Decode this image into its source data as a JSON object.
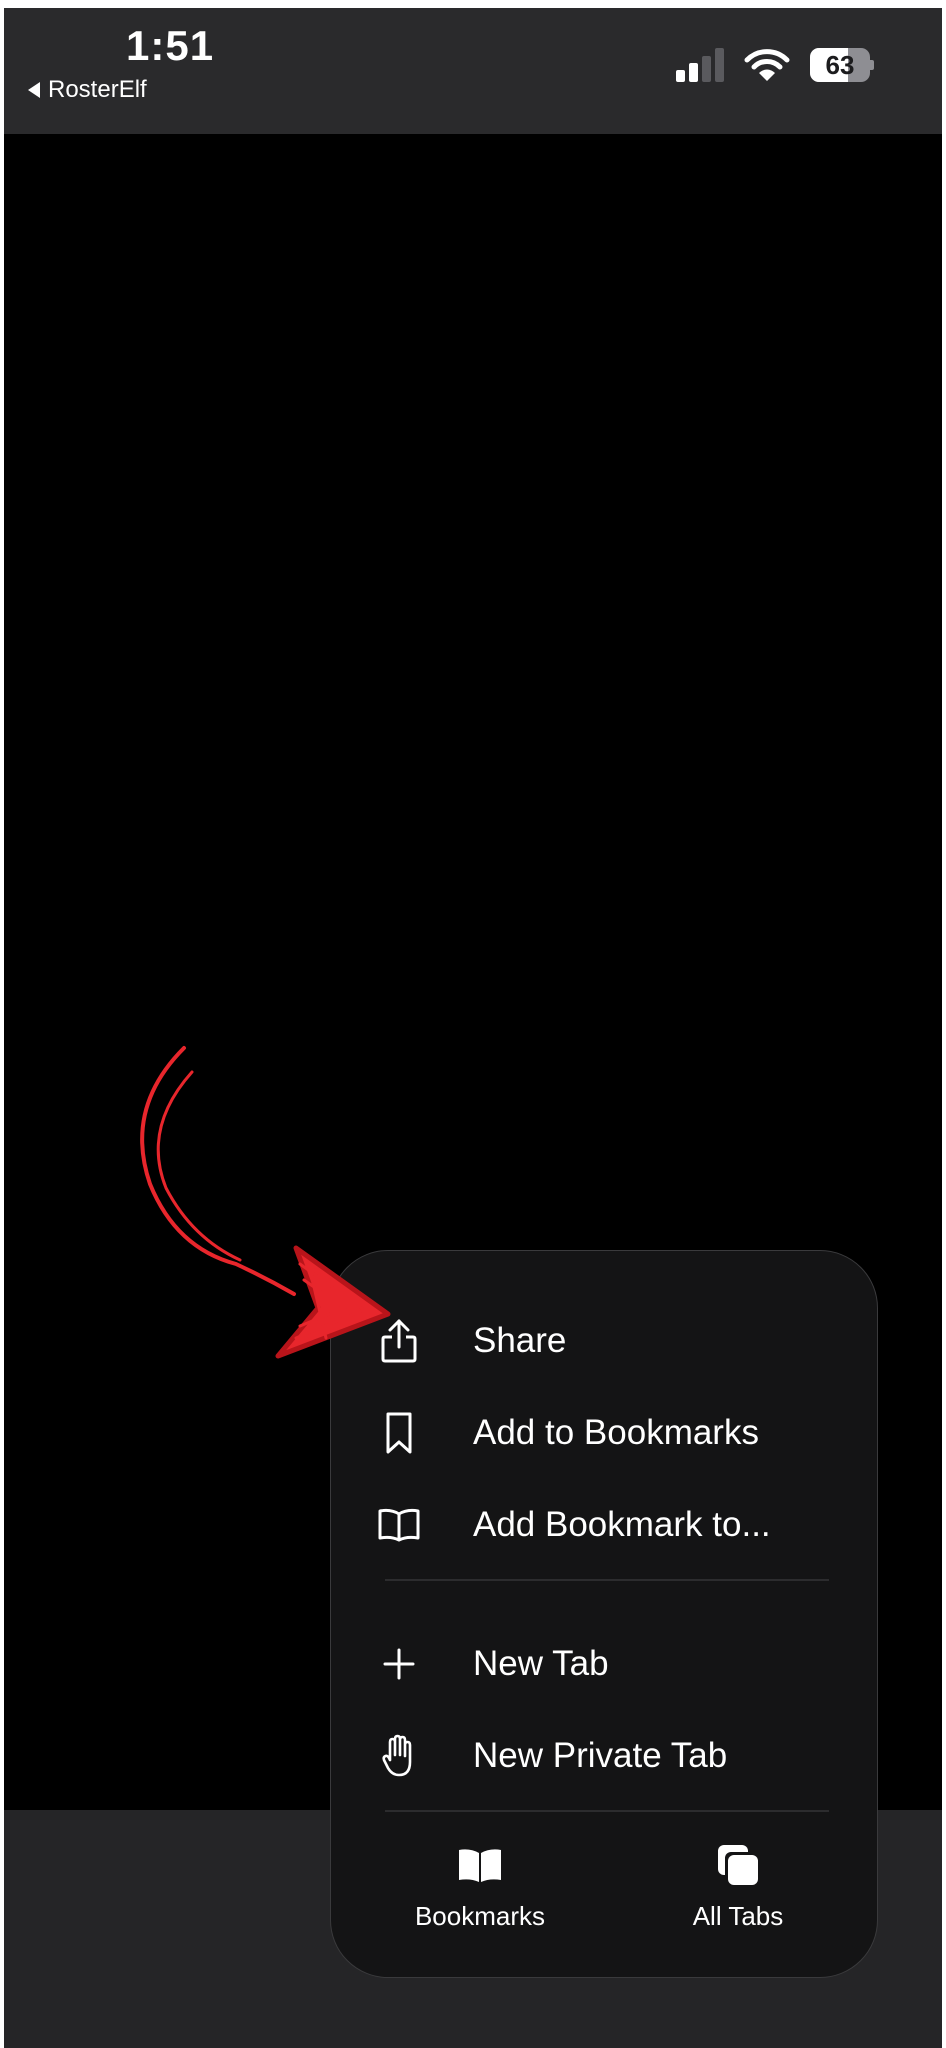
{
  "status_bar": {
    "time": "1:51",
    "back_label": "RosterElf",
    "battery_percent": "63",
    "battery_level": 0.63,
    "signal_bars_active": 2,
    "signal_bars_total": 4
  },
  "menu": {
    "items": [
      {
        "label": "Share",
        "icon": "share-icon"
      },
      {
        "label": "Add to Bookmarks",
        "icon": "bookmark-icon"
      },
      {
        "label": "Add Bookmark to...",
        "icon": "book-open-icon"
      },
      {
        "label": "New Tab",
        "icon": "plus-icon"
      },
      {
        "label": "New Private Tab",
        "icon": "hand-icon"
      }
    ],
    "bottom_buttons": [
      {
        "label": "Bookmarks",
        "icon": "bookmarks-book-icon"
      },
      {
        "label": "All Tabs",
        "icon": "tabs-stack-icon"
      }
    ]
  },
  "colors": {
    "annotation_arrow": "#e8262c",
    "menu_background": "#141415",
    "toolbar_background": "#252527",
    "status_background": "#2a2a2c"
  }
}
